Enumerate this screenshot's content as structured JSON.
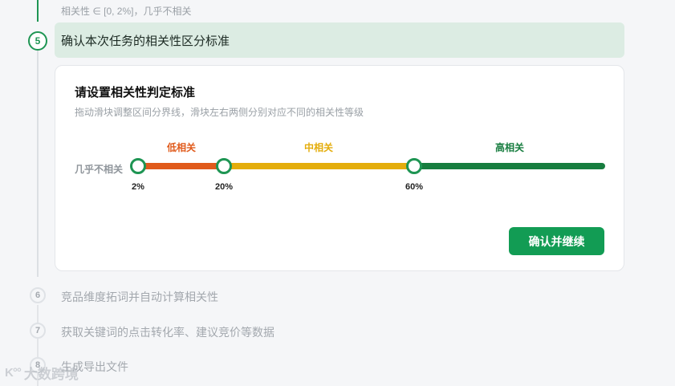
{
  "previous_step": {
    "text": "相关性 ∈ [0, 2%]，几乎不相关"
  },
  "current_step": {
    "number": "5",
    "title": "确认本次任务的相关性区分标准"
  },
  "card": {
    "title": "请设置相关性判定标准",
    "description": "拖动滑块调整区间分界线，滑块左右两侧分别对应不同的相关性等级",
    "edge_label": "几乎不相关",
    "zones": [
      {
        "label": "低相关",
        "color": "#e05a1b"
      },
      {
        "label": "中相关",
        "color": "#e4ad0c"
      },
      {
        "label": "高相关",
        "color": "#177d3f"
      }
    ],
    "thresholds": [
      {
        "label": "2%",
        "value": 2
      },
      {
        "label": "20%",
        "value": 20
      },
      {
        "label": "60%",
        "value": 60
      }
    ],
    "confirm_button": "确认并继续"
  },
  "upcoming_steps": [
    {
      "number": "6",
      "title": "竞品维度拓词并自动计算相关性"
    },
    {
      "number": "7",
      "title": "获取关键词的点击转化率、建议竞价等数据"
    },
    {
      "number": "8",
      "title": "生成导出文件"
    }
  ],
  "watermark": {
    "text": "大数跨境"
  },
  "colors": {
    "accent": "#1e9553",
    "button": "#129c54",
    "active_bg": "#dcece3"
  }
}
